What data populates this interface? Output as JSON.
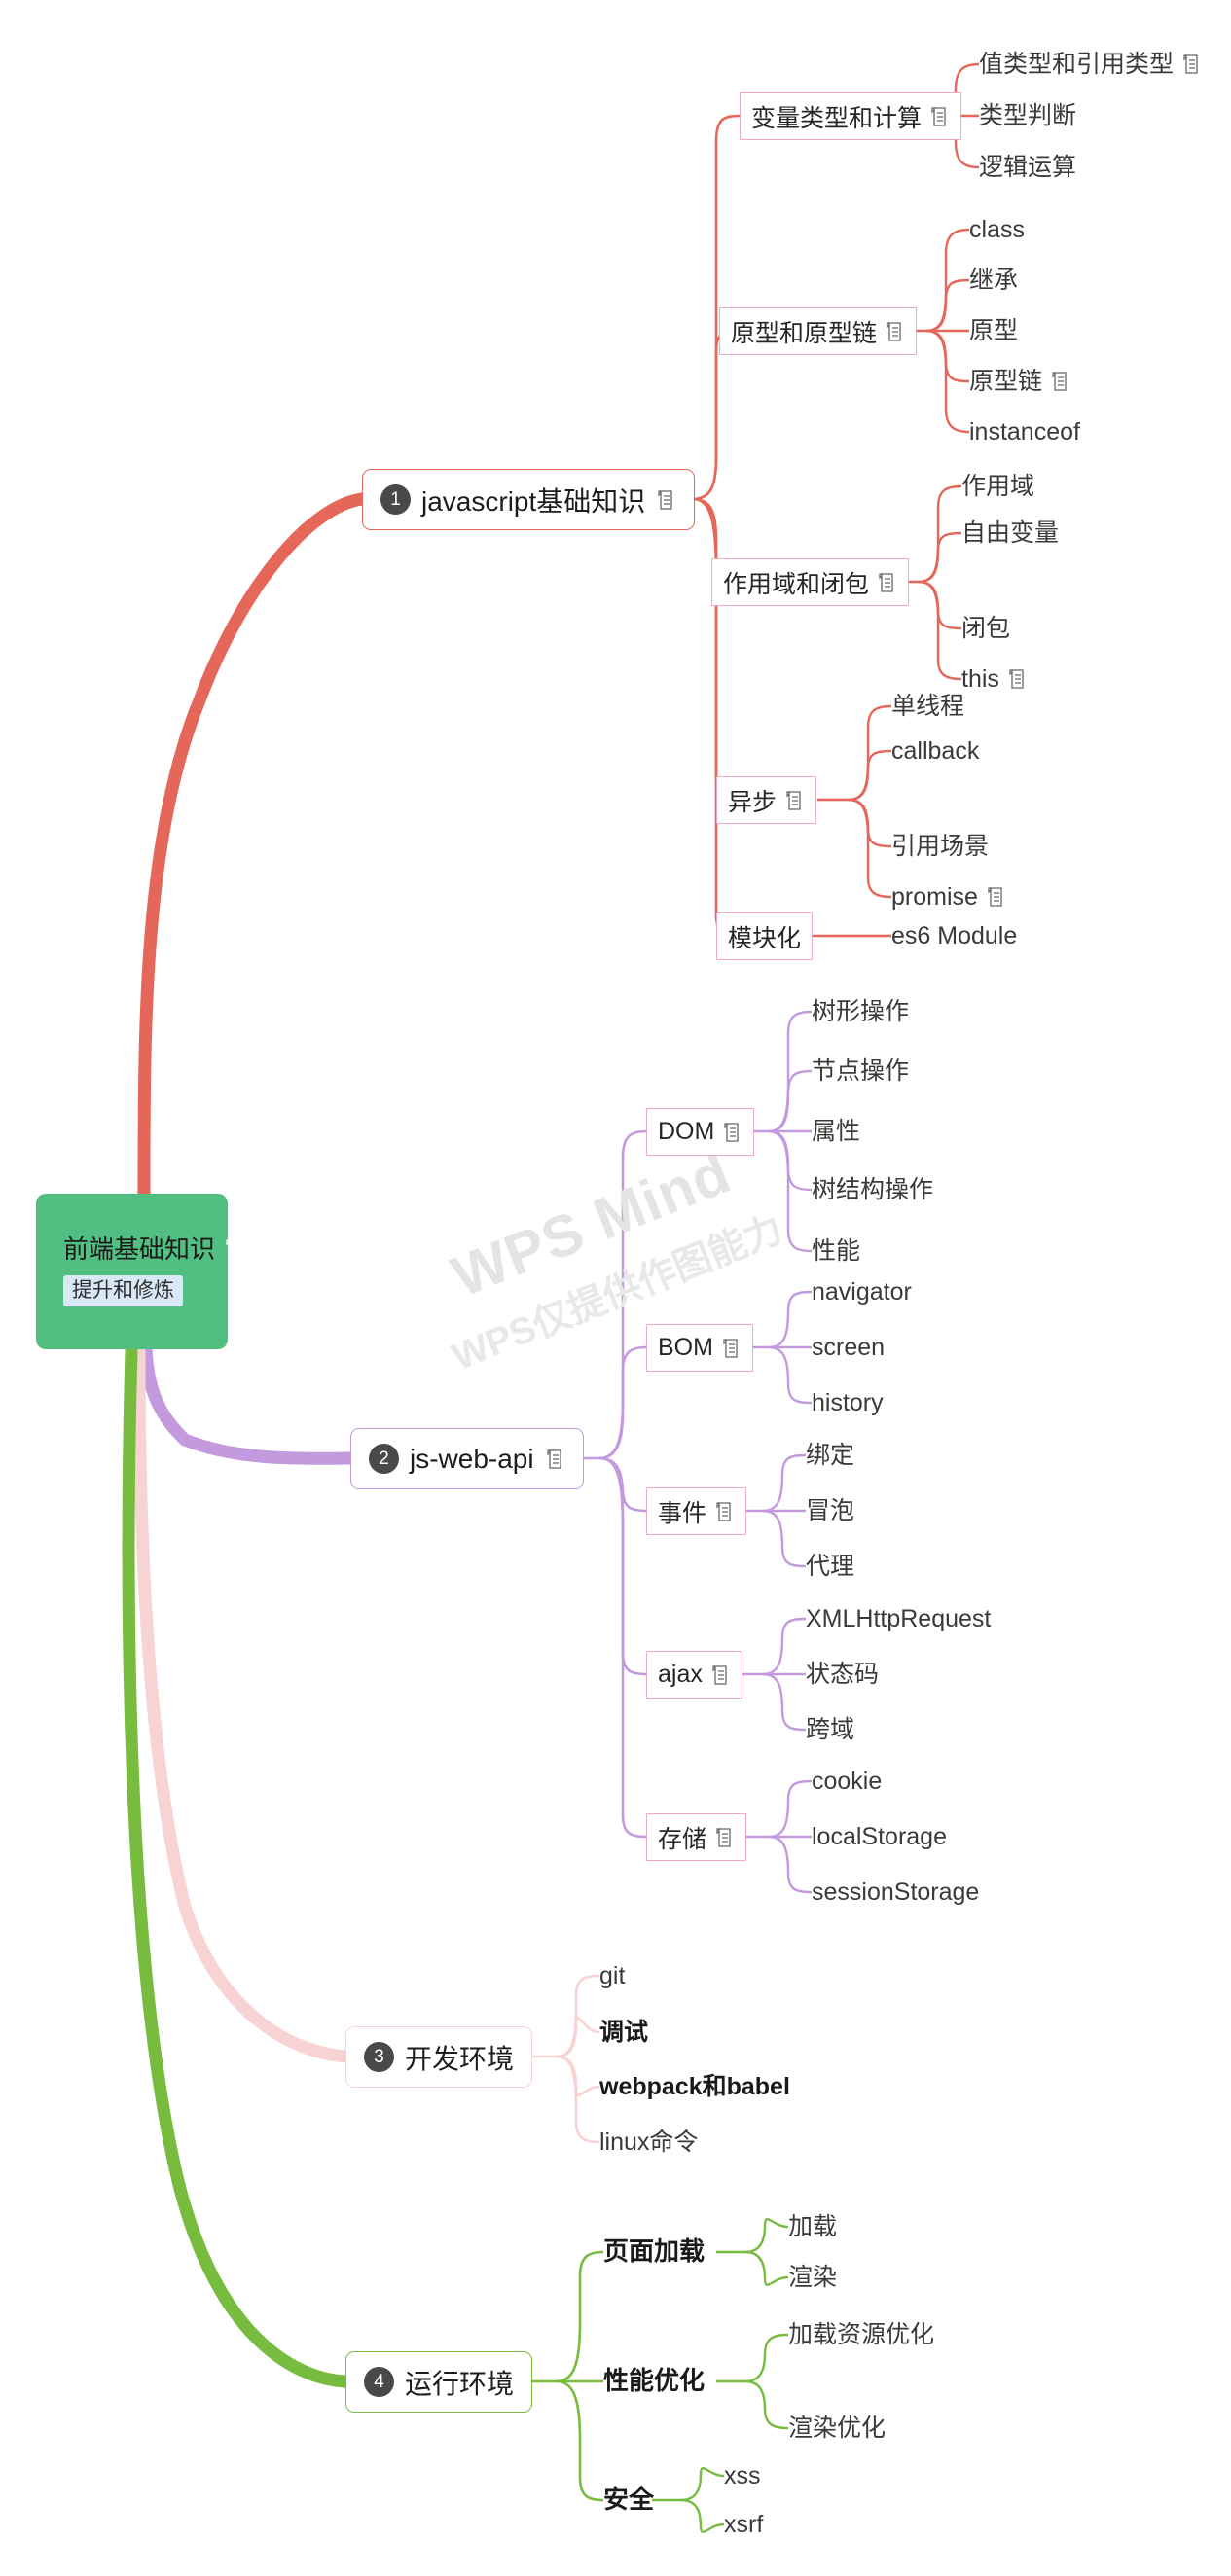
{
  "watermark": {
    "line1": "WPS Mind",
    "line2": "WPS仅提供作图能力"
  },
  "colors": {
    "root_fill": "#52bf82",
    "root_tag_fill": "#d8e8f7",
    "branch_red": "#e4675a",
    "branch_purple": "#c49ade",
    "branch_pink": "#f8d3d3",
    "branch_green": "#77bb3f",
    "sub_border_pink": "#f1a8c4",
    "badge_fill": "#494949"
  },
  "root": {
    "title": "前端基础知识",
    "note_icon": "note-icon",
    "tag": "提升和修炼"
  },
  "branches": [
    {
      "index": "1",
      "label": "javascript基础知识",
      "has_note": true,
      "color": "#e4675a",
      "children": [
        {
          "label": "变量类型和计算",
          "has_note": true,
          "boxed": true,
          "children": [
            {
              "label": "值类型和引用类型",
              "has_note": true
            },
            {
              "label": "类型判断",
              "has_note": false
            },
            {
              "label": "逻辑运算",
              "has_note": false
            }
          ]
        },
        {
          "label": "原型和原型链",
          "has_note": true,
          "boxed": true,
          "children": [
            {
              "label": "class",
              "has_note": false
            },
            {
              "label": "继承",
              "has_note": false
            },
            {
              "label": "原型",
              "has_note": false
            },
            {
              "label": "原型链",
              "has_note": true
            },
            {
              "label": "instanceof",
              "has_note": false
            }
          ]
        },
        {
          "label": "作用域和闭包",
          "has_note": true,
          "boxed": true,
          "children": [
            {
              "label": "作用域",
              "has_note": false
            },
            {
              "label": "自由变量",
              "has_note": false
            },
            {
              "label": "闭包",
              "has_note": false
            },
            {
              "label": "this",
              "has_note": true
            }
          ]
        },
        {
          "label": "异步",
          "has_note": true,
          "boxed": true,
          "children": [
            {
              "label": "单线程",
              "has_note": false
            },
            {
              "label": "callback",
              "has_note": false
            },
            {
              "label": "引用场景",
              "has_note": false
            },
            {
              "label": "promise",
              "has_note": true
            }
          ]
        },
        {
          "label": "模块化",
          "has_note": false,
          "boxed": true,
          "children": [
            {
              "label": "es6 Module",
              "has_note": false
            }
          ]
        }
      ]
    },
    {
      "index": "2",
      "label": "js-web-api",
      "has_note": true,
      "color": "#c49ade",
      "children": [
        {
          "label": "DOM",
          "has_note": true,
          "boxed": true,
          "children": [
            {
              "label": "树形操作",
              "has_note": false
            },
            {
              "label": "节点操作",
              "has_note": false
            },
            {
              "label": "属性",
              "has_note": false
            },
            {
              "label": "树结构操作",
              "has_note": false
            },
            {
              "label": "性能",
              "has_note": false
            }
          ]
        },
        {
          "label": "BOM",
          "has_note": true,
          "boxed": true,
          "children": [
            {
              "label": "navigator",
              "has_note": false
            },
            {
              "label": "screen",
              "has_note": false
            },
            {
              "label": "history",
              "has_note": false
            }
          ]
        },
        {
          "label": "事件",
          "has_note": true,
          "boxed": true,
          "children": [
            {
              "label": "绑定",
              "has_note": false
            },
            {
              "label": "冒泡",
              "has_note": false
            },
            {
              "label": "代理",
              "has_note": false
            }
          ]
        },
        {
          "label": "ajax",
          "has_note": true,
          "boxed": true,
          "children": [
            {
              "label": "XMLHttpRequest",
              "has_note": false
            },
            {
              "label": "状态码",
              "has_note": false
            },
            {
              "label": "跨域",
              "has_note": false
            }
          ]
        },
        {
          "label": "存储",
          "has_note": true,
          "boxed": true,
          "children": [
            {
              "label": "cookie",
              "has_note": false
            },
            {
              "label": "localStorage",
              "has_note": false
            },
            {
              "label": "sessionStorage",
              "has_note": false
            }
          ]
        }
      ]
    },
    {
      "index": "3",
      "label": "开发环境",
      "has_note": false,
      "color": "#f8d3d3",
      "children": [
        {
          "label": "git",
          "has_note": false,
          "boxed": false,
          "bold": false,
          "children": []
        },
        {
          "label": "调试",
          "has_note": false,
          "boxed": false,
          "bold": true,
          "children": []
        },
        {
          "label": "webpack和babel",
          "has_note": false,
          "boxed": false,
          "bold": true,
          "children": []
        },
        {
          "label": "linux命令",
          "has_note": false,
          "boxed": false,
          "bold": false,
          "children": []
        }
      ]
    },
    {
      "index": "4",
      "label": "运行环境",
      "has_note": false,
      "color": "#77bb3f",
      "children": [
        {
          "label": "页面加载",
          "has_note": false,
          "boxed": false,
          "bold": true,
          "children": [
            {
              "label": "加载",
              "has_note": false
            },
            {
              "label": "渲染",
              "has_note": false
            }
          ]
        },
        {
          "label": "性能优化",
          "has_note": false,
          "boxed": false,
          "bold": true,
          "children": [
            {
              "label": "加载资源优化",
              "has_note": false
            },
            {
              "label": "渲染优化",
              "has_note": false
            }
          ]
        },
        {
          "label": "安全",
          "has_note": false,
          "boxed": false,
          "bold": true,
          "children": [
            {
              "label": "xss",
              "has_note": false
            },
            {
              "label": "xsrf",
              "has_note": false
            }
          ]
        }
      ]
    }
  ]
}
